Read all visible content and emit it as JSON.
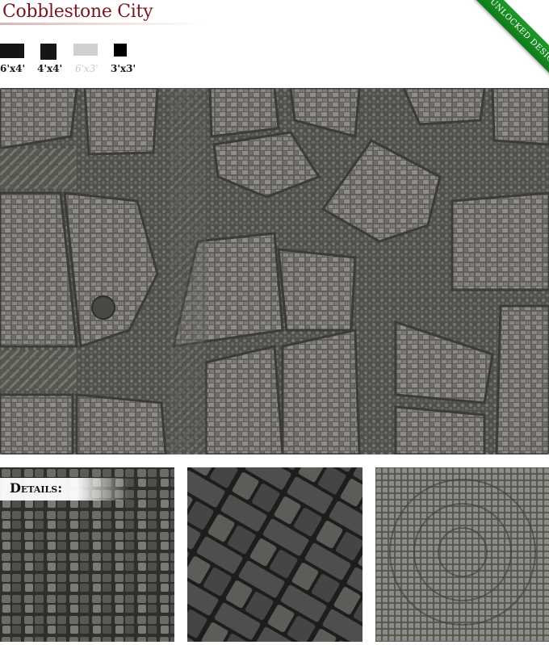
{
  "header": {
    "title": "Cobblestone City"
  },
  "ribbon": {
    "label": "UNLOCKED DESIGN",
    "color": "#1e9a2b"
  },
  "sizes": [
    {
      "label": "6'x4'",
      "available": true
    },
    {
      "label": "4'x4'",
      "available": true
    },
    {
      "label": "6'x3'",
      "available": false
    },
    {
      "label": "3'x3'",
      "available": true
    }
  ],
  "details": {
    "label": "Details:"
  }
}
